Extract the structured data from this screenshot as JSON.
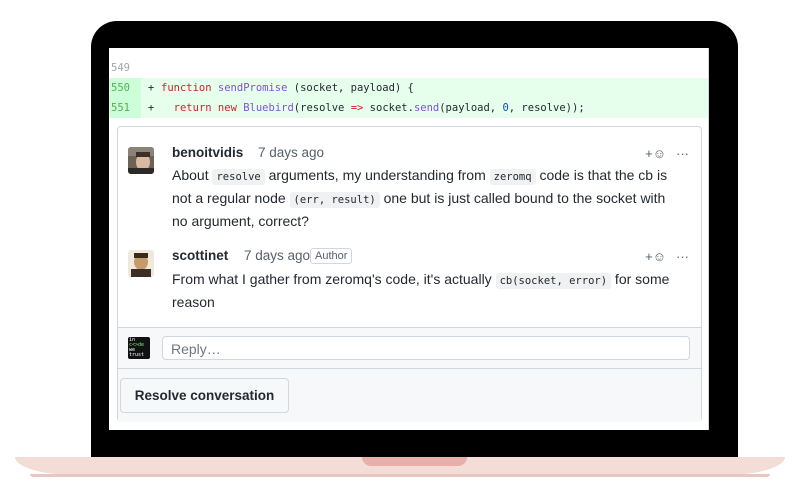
{
  "code": {
    "lines": [
      {
        "num": "549",
        "mark": "",
        "text": ""
      },
      {
        "num": "550",
        "mark": "+"
      },
      {
        "num": "551",
        "mark": "+"
      }
    ],
    "line550": {
      "kw": "function",
      "fn": "sendPromise",
      "rest": " (socket, payload) {"
    },
    "line551": {
      "kw1": "return",
      "kw2": "new",
      "cls": "Bluebird",
      "rest1": "(resolve ",
      "arrow": "=>",
      "rest2": " socket.",
      "call": "send",
      "rest3": "(payload, ",
      "num": "0",
      "rest4": ", resolve));"
    }
  },
  "comments": [
    {
      "author": "benoitvidis",
      "time": "7 days ago",
      "reaction": "+☺",
      "more": "···",
      "body": {
        "t1": "About ",
        "c1": "resolve",
        "t2": " arguments, my understanding from ",
        "c2": "zeromq",
        "t3": " code is that the cb is not a regular node ",
        "c3": "(err, result)",
        "t4": " one but is just called bound to the socket with no argument, correct?"
      }
    },
    {
      "author": "scottinet",
      "time": "7 days ago",
      "badge": "Author",
      "reaction": "+☺",
      "more": "···",
      "body": {
        "t1": "From what I gather from zeromq's code, it's actually ",
        "c1": "cb(socket, error)",
        "t2": " for some reason"
      }
    }
  ],
  "reply": {
    "placeholder": "Reply…",
    "avatar_text": [
      "in",
      "c<>de",
      "we",
      "trust"
    ]
  },
  "resolve": {
    "label": "Resolve conversation"
  },
  "colors": {
    "added_bg": "#e6ffec",
    "added_gutter": "#ccffd8",
    "frame": "#000000",
    "base": "#f4dcd7"
  }
}
